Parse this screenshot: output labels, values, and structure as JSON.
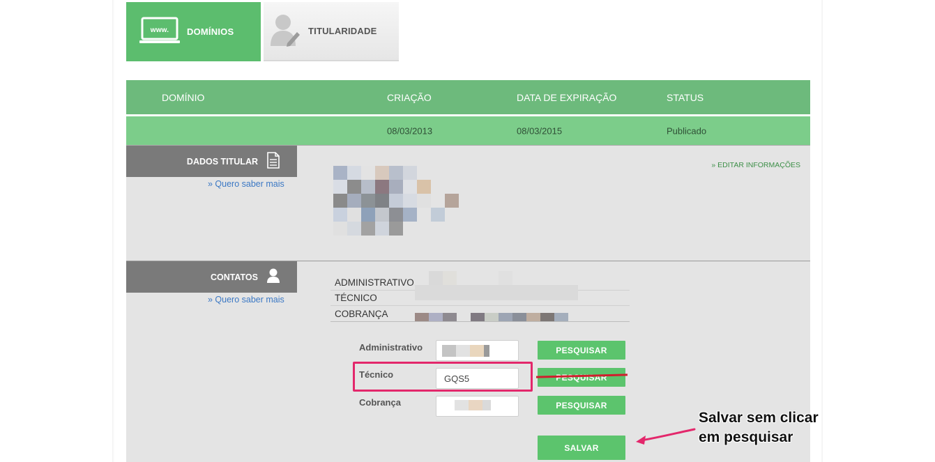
{
  "tabs": [
    {
      "label": "DOMÍNIOS",
      "icon": "www-monitor-icon",
      "active": true
    },
    {
      "label": "TITULARIDADE",
      "icon": "user-edit-icon",
      "active": false
    }
  ],
  "domain_table": {
    "headers": [
      "DOMÍNIO",
      "CRIAÇÃO",
      "DATA DE EXPIRAÇÃO",
      "STATUS"
    ],
    "row": {
      "domain": "",
      "created": "08/03/2013",
      "expires": "08/03/2015",
      "status": "Publicado"
    }
  },
  "dados_titular": {
    "title": "DADOS TITULAR",
    "icon": "document-icon",
    "know_more": "» Quero saber mais",
    "edit_link": "» EDITAR INFORMAÇÕES"
  },
  "contatos": {
    "title": "CONTATOS",
    "icon": "user-icon",
    "know_more": "» Quero saber mais",
    "list": [
      "ADMINISTRATIVO",
      "TÉCNICO",
      "COBRANÇA"
    ]
  },
  "form": {
    "fields": [
      {
        "label": "Administrativo",
        "value": "",
        "button": "PESQUISAR"
      },
      {
        "label": "Técnico",
        "value": "GQS5",
        "button": "PESQUISAR"
      },
      {
        "label": "Cobrança",
        "value": "",
        "button": "PESQUISAR"
      }
    ],
    "save_label": "SALVAR"
  },
  "annotation": {
    "line1": "Salvar sem clicar",
    "line2": "em pesquisar",
    "color": "#e3276b"
  },
  "colors": {
    "accent_green": "#5cbd6e",
    "header_green": "#6dba7c",
    "row_green": "#7ccd8a",
    "button_green": "#5cc46d",
    "panel_gray": "#e4e4e4",
    "section_gray": "#7a7a7a",
    "link_blue": "#3b78c4",
    "highlight_pink": "#e3276b",
    "strike_red": "#d01f2e"
  }
}
